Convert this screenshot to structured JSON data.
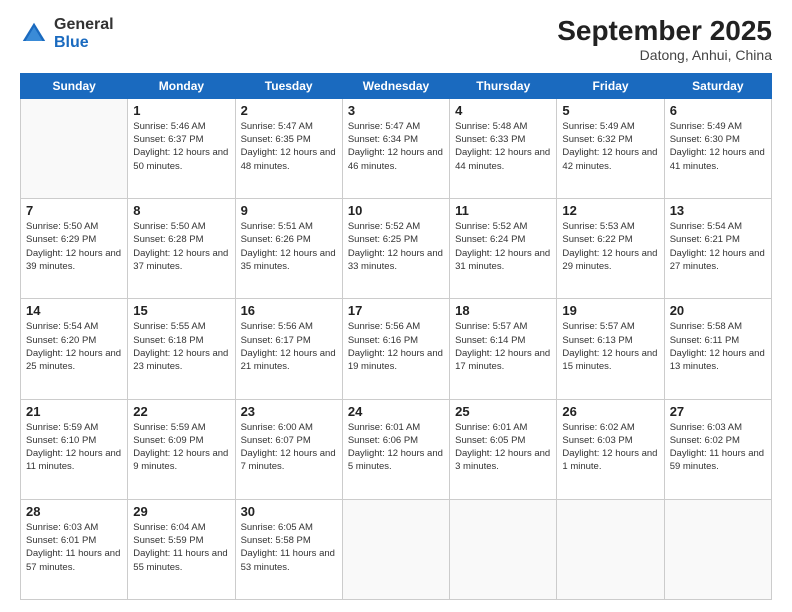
{
  "logo": {
    "general": "General",
    "blue": "Blue"
  },
  "title": "September 2025",
  "location": "Datong, Anhui, China",
  "weekdays": [
    "Sunday",
    "Monday",
    "Tuesday",
    "Wednesday",
    "Thursday",
    "Friday",
    "Saturday"
  ],
  "weeks": [
    [
      {
        "day": "",
        "sunrise": "",
        "sunset": "",
        "daylight": ""
      },
      {
        "day": "1",
        "sunrise": "Sunrise: 5:46 AM",
        "sunset": "Sunset: 6:37 PM",
        "daylight": "Daylight: 12 hours and 50 minutes."
      },
      {
        "day": "2",
        "sunrise": "Sunrise: 5:47 AM",
        "sunset": "Sunset: 6:35 PM",
        "daylight": "Daylight: 12 hours and 48 minutes."
      },
      {
        "day": "3",
        "sunrise": "Sunrise: 5:47 AM",
        "sunset": "Sunset: 6:34 PM",
        "daylight": "Daylight: 12 hours and 46 minutes."
      },
      {
        "day": "4",
        "sunrise": "Sunrise: 5:48 AM",
        "sunset": "Sunset: 6:33 PM",
        "daylight": "Daylight: 12 hours and 44 minutes."
      },
      {
        "day": "5",
        "sunrise": "Sunrise: 5:49 AM",
        "sunset": "Sunset: 6:32 PM",
        "daylight": "Daylight: 12 hours and 42 minutes."
      },
      {
        "day": "6",
        "sunrise": "Sunrise: 5:49 AM",
        "sunset": "Sunset: 6:30 PM",
        "daylight": "Daylight: 12 hours and 41 minutes."
      }
    ],
    [
      {
        "day": "7",
        "sunrise": "Sunrise: 5:50 AM",
        "sunset": "Sunset: 6:29 PM",
        "daylight": "Daylight: 12 hours and 39 minutes."
      },
      {
        "day": "8",
        "sunrise": "Sunrise: 5:50 AM",
        "sunset": "Sunset: 6:28 PM",
        "daylight": "Daylight: 12 hours and 37 minutes."
      },
      {
        "day": "9",
        "sunrise": "Sunrise: 5:51 AM",
        "sunset": "Sunset: 6:26 PM",
        "daylight": "Daylight: 12 hours and 35 minutes."
      },
      {
        "day": "10",
        "sunrise": "Sunrise: 5:52 AM",
        "sunset": "Sunset: 6:25 PM",
        "daylight": "Daylight: 12 hours and 33 minutes."
      },
      {
        "day": "11",
        "sunrise": "Sunrise: 5:52 AM",
        "sunset": "Sunset: 6:24 PM",
        "daylight": "Daylight: 12 hours and 31 minutes."
      },
      {
        "day": "12",
        "sunrise": "Sunrise: 5:53 AM",
        "sunset": "Sunset: 6:22 PM",
        "daylight": "Daylight: 12 hours and 29 minutes."
      },
      {
        "day": "13",
        "sunrise": "Sunrise: 5:54 AM",
        "sunset": "Sunset: 6:21 PM",
        "daylight": "Daylight: 12 hours and 27 minutes."
      }
    ],
    [
      {
        "day": "14",
        "sunrise": "Sunrise: 5:54 AM",
        "sunset": "Sunset: 6:20 PM",
        "daylight": "Daylight: 12 hours and 25 minutes."
      },
      {
        "day": "15",
        "sunrise": "Sunrise: 5:55 AM",
        "sunset": "Sunset: 6:18 PM",
        "daylight": "Daylight: 12 hours and 23 minutes."
      },
      {
        "day": "16",
        "sunrise": "Sunrise: 5:56 AM",
        "sunset": "Sunset: 6:17 PM",
        "daylight": "Daylight: 12 hours and 21 minutes."
      },
      {
        "day": "17",
        "sunrise": "Sunrise: 5:56 AM",
        "sunset": "Sunset: 6:16 PM",
        "daylight": "Daylight: 12 hours and 19 minutes."
      },
      {
        "day": "18",
        "sunrise": "Sunrise: 5:57 AM",
        "sunset": "Sunset: 6:14 PM",
        "daylight": "Daylight: 12 hours and 17 minutes."
      },
      {
        "day": "19",
        "sunrise": "Sunrise: 5:57 AM",
        "sunset": "Sunset: 6:13 PM",
        "daylight": "Daylight: 12 hours and 15 minutes."
      },
      {
        "day": "20",
        "sunrise": "Sunrise: 5:58 AM",
        "sunset": "Sunset: 6:11 PM",
        "daylight": "Daylight: 12 hours and 13 minutes."
      }
    ],
    [
      {
        "day": "21",
        "sunrise": "Sunrise: 5:59 AM",
        "sunset": "Sunset: 6:10 PM",
        "daylight": "Daylight: 12 hours and 11 minutes."
      },
      {
        "day": "22",
        "sunrise": "Sunrise: 5:59 AM",
        "sunset": "Sunset: 6:09 PM",
        "daylight": "Daylight: 12 hours and 9 minutes."
      },
      {
        "day": "23",
        "sunrise": "Sunrise: 6:00 AM",
        "sunset": "Sunset: 6:07 PM",
        "daylight": "Daylight: 12 hours and 7 minutes."
      },
      {
        "day": "24",
        "sunrise": "Sunrise: 6:01 AM",
        "sunset": "Sunset: 6:06 PM",
        "daylight": "Daylight: 12 hours and 5 minutes."
      },
      {
        "day": "25",
        "sunrise": "Sunrise: 6:01 AM",
        "sunset": "Sunset: 6:05 PM",
        "daylight": "Daylight: 12 hours and 3 minutes."
      },
      {
        "day": "26",
        "sunrise": "Sunrise: 6:02 AM",
        "sunset": "Sunset: 6:03 PM",
        "daylight": "Daylight: 12 hours and 1 minute."
      },
      {
        "day": "27",
        "sunrise": "Sunrise: 6:03 AM",
        "sunset": "Sunset: 6:02 PM",
        "daylight": "Daylight: 11 hours and 59 minutes."
      }
    ],
    [
      {
        "day": "28",
        "sunrise": "Sunrise: 6:03 AM",
        "sunset": "Sunset: 6:01 PM",
        "daylight": "Daylight: 11 hours and 57 minutes."
      },
      {
        "day": "29",
        "sunrise": "Sunrise: 6:04 AM",
        "sunset": "Sunset: 5:59 PM",
        "daylight": "Daylight: 11 hours and 55 minutes."
      },
      {
        "day": "30",
        "sunrise": "Sunrise: 6:05 AM",
        "sunset": "Sunset: 5:58 PM",
        "daylight": "Daylight: 11 hours and 53 minutes."
      },
      {
        "day": "",
        "sunrise": "",
        "sunset": "",
        "daylight": ""
      },
      {
        "day": "",
        "sunrise": "",
        "sunset": "",
        "daylight": ""
      },
      {
        "day": "",
        "sunrise": "",
        "sunset": "",
        "daylight": ""
      },
      {
        "day": "",
        "sunrise": "",
        "sunset": "",
        "daylight": ""
      }
    ]
  ]
}
